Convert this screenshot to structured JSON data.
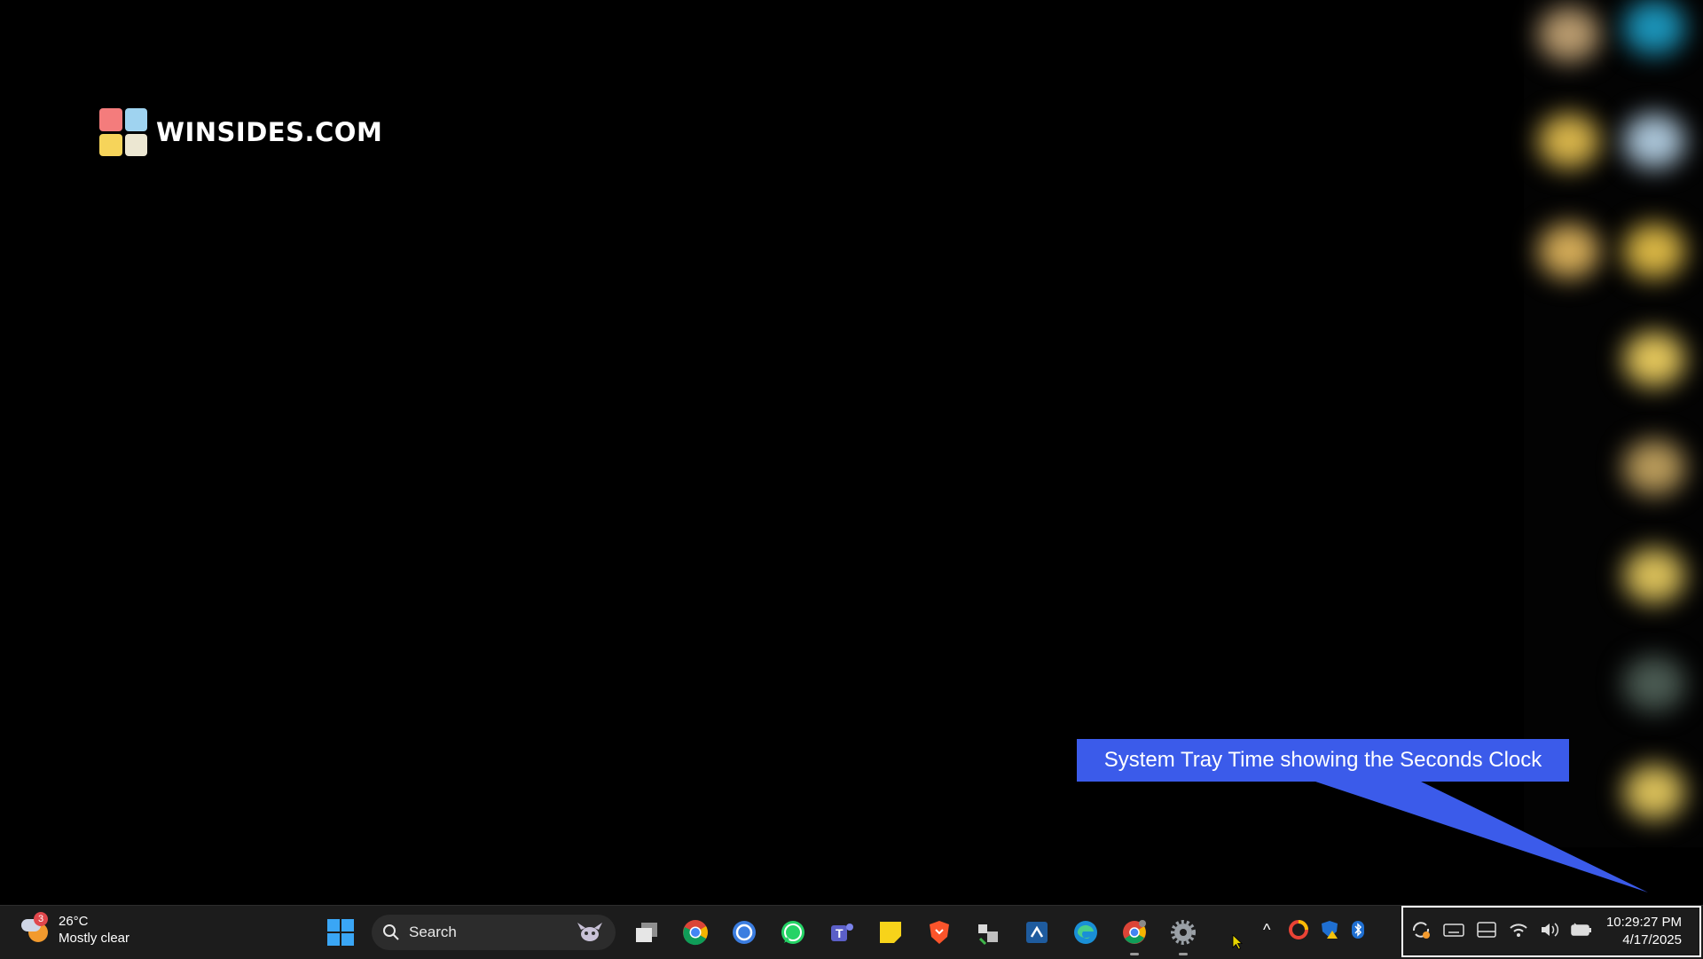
{
  "brand": {
    "name": "WINSIDES.COM"
  },
  "callout": {
    "text": "System Tray Time showing the Seconds Clock",
    "color": "#3b5bea"
  },
  "weather": {
    "temperature": "26°C",
    "condition": "Mostly clear",
    "badge": "3"
  },
  "search": {
    "placeholder": "Search"
  },
  "taskbar_apps": [
    "windows-start-icon",
    "task-view-icon",
    "chrome-icon",
    "sync-app-icon",
    "whatsapp-icon",
    "teams-icon",
    "sticky-notes-icon",
    "brave-icon",
    "network-tool-icon",
    "remote-app-icon",
    "edge-icon",
    "chrome-profile-icon",
    "settings-icon"
  ],
  "tray": {
    "overflow_label": "^"
  },
  "clock": {
    "time": "10:29:27 PM",
    "date": "4/17/2025"
  }
}
